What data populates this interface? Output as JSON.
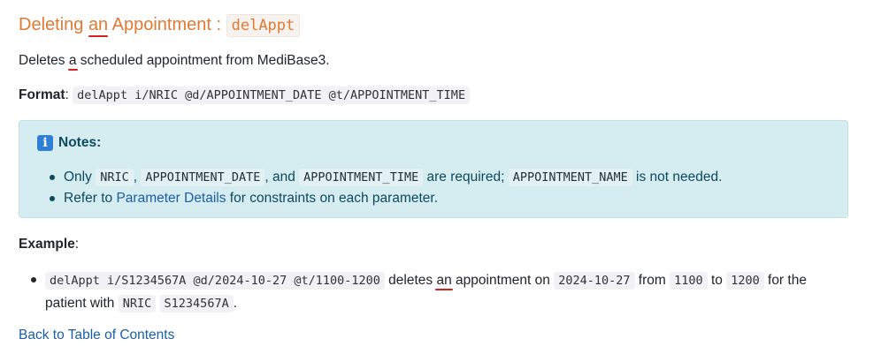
{
  "heading": {
    "prefix": "Deleting ",
    "highlighted": "an",
    "suffix": " Appointment : ",
    "command": "delAppt"
  },
  "intro": {
    "before": "Deletes ",
    "highlighted": "a",
    "after": " scheduled appointment from MediBase3."
  },
  "format": {
    "label": "Format",
    "colon": ":",
    "command": "delAppt i/NRIC @d/APPOINTMENT_DATE @t/APPOINTMENT_TIME"
  },
  "notes": {
    "icon": "info-icon",
    "title": "Notes:",
    "item1": {
      "t1": "Only ",
      "c1": "NRIC",
      "t2": ", ",
      "c2": "APPOINTMENT_DATE",
      "t3": ", and ",
      "c3": "APPOINTMENT_TIME",
      "t4": " are required; ",
      "c4": "APPOINTMENT_NAME",
      "t5": " is not needed."
    },
    "item2": {
      "t1": "Refer to ",
      "link": "Parameter Details",
      "t2": " for constraints on each parameter."
    }
  },
  "example": {
    "label": "Example",
    "colon": ":",
    "item": {
      "c1": "delAppt i/S1234567A @d/2024-10-27 @t/1100-1200",
      "t1": " deletes ",
      "hl": "an",
      "t2": " appointment on ",
      "c2": "2024-10-27",
      "t3": " from ",
      "c3": "1100",
      "t4": " to ",
      "c4": "1200",
      "t5": " for the",
      "t6": "patient with ",
      "c5": "NRIC",
      "c6": "S1234567A",
      "t7": "."
    }
  },
  "back_link": "Back to Table of Contents",
  "colors": {
    "heading": "#e07a33",
    "notes_bg": "#d5ecf0",
    "link": "#1a5ea8",
    "spell_underline": "#d61f1f"
  }
}
